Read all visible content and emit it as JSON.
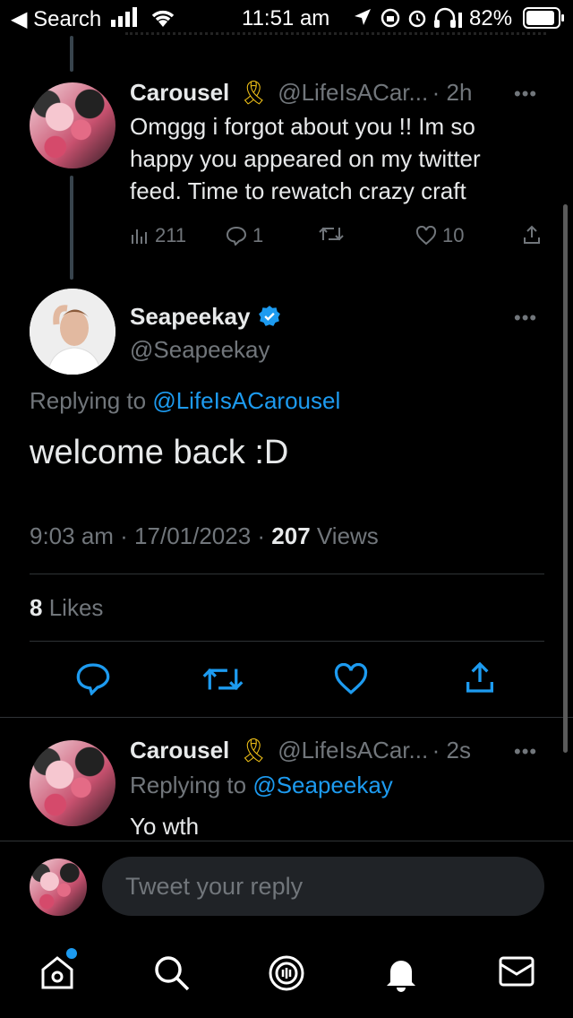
{
  "status_bar": {
    "back_label": "◀ Search",
    "time": "11:51 am",
    "battery": "82%"
  },
  "tweet1": {
    "name": "Carousel",
    "badge": "🎗",
    "handle": "@LifeIsACar...",
    "time": "· 2h",
    "text_line1": "Omggg i forgot about you !! Im so",
    "text_line2": "happy you appeared on my twitter",
    "text_line3": "feed. Time to rewatch crazy craft",
    "views": "211",
    "replies": "1",
    "likes": "10"
  },
  "main_tweet": {
    "name": "Seapeekay",
    "handle": "@Seapeekay",
    "replying_prefix": "Replying to",
    "replying_to": "@LifeIsACarousel",
    "text": "welcome back :D",
    "timestamp": "9:03 am · 17/01/2023 ·",
    "views_count": "207",
    "views_label": "Views",
    "likes_count": "8",
    "likes_label": "Likes"
  },
  "reply_tweet": {
    "name": "Carousel",
    "badge": "🎗",
    "handle": "@LifeIsACar...",
    "time": "· 2s",
    "replying_prefix": "Replying to",
    "replying_to": "@Seapeekay",
    "text": "Yo wth"
  },
  "composer": {
    "placeholder": "Tweet your reply"
  },
  "colors": {
    "accent": "#1d9bf0",
    "ribbon": "#f5c518",
    "verified": "#1d9bf0"
  },
  "icons": [
    "home-icon",
    "search-icon",
    "spaces-icon",
    "notifications-icon",
    "messages-icon"
  ]
}
